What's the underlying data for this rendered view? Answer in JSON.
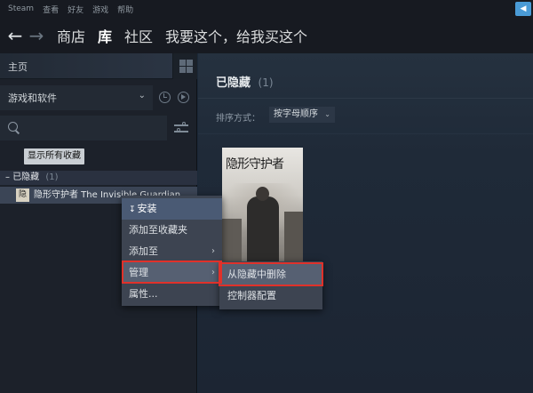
{
  "menubar": {
    "items": [
      "Steam",
      "查看",
      "好友",
      "游戏",
      "帮助"
    ],
    "tray_icon": "megaphone-icon"
  },
  "nav": {
    "links": [
      "商店",
      "库",
      "社区",
      "我要这个，给我买这个"
    ],
    "active": "库"
  },
  "left": {
    "home_label": "主页",
    "filter_label": "游戏和软件",
    "show_all_label": "显示所有收藏",
    "collection": {
      "name": "已隐藏",
      "count": "(1)"
    },
    "game": {
      "name": "隐形守护者 The Invisible Guardian",
      "icon_text": "隐"
    }
  },
  "right": {
    "section_title": "已隐藏",
    "section_count": "(1)",
    "sort_label": "排序方式：",
    "sort_value": "按字母顺序",
    "cover_title_art": "隐形守护者"
  },
  "context_menu": {
    "install": "安装",
    "add_to_collection": "添加至收藏夹",
    "add_to": "添加至",
    "manage": "管理",
    "properties": "属性..."
  },
  "submenu": {
    "remove_hidden": "从隐藏中删除",
    "controller_config": "控制器配置"
  },
  "colors": {
    "highlight_border": "#e0312a",
    "menu_bg": "#3d4451",
    "menu_hover": "#566072"
  }
}
